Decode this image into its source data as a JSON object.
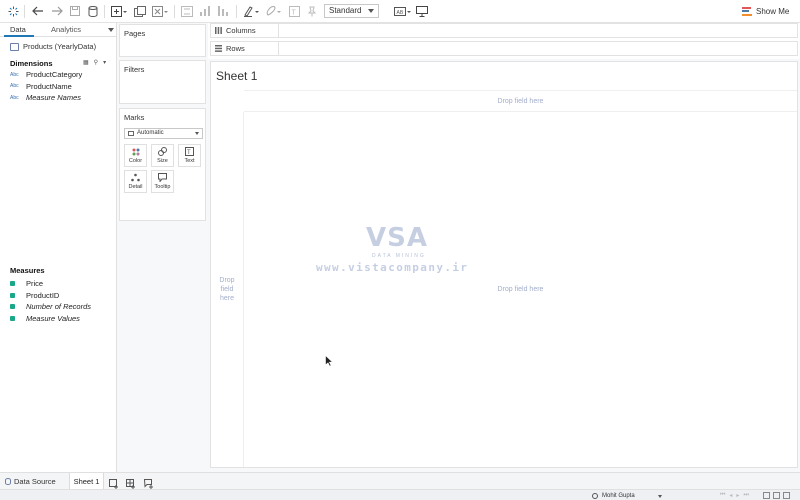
{
  "toolbar": {
    "standard_label": "Standard",
    "show_me_label": "Show Me",
    "show_me_colors": [
      "#e15759",
      "#4e79a7",
      "#f28e2b"
    ],
    "icons": [
      "tableau-logo-icon",
      "undo-icon",
      "redo-icon",
      "save-icon",
      "new-datasource-icon",
      "new-worksheet-icon",
      "duplicate-icon",
      "clear-icon",
      "swap-icon",
      "sort-ascending-icon",
      "sort-descending-icon",
      "highlight-icon",
      "group-icon",
      "label-icon",
      "pin-icon",
      "fit-icon",
      "presentation-icon"
    ]
  },
  "data_pane": {
    "tabs": {
      "data": "Data",
      "analytics": "Analytics"
    },
    "datasource": "Products (YearlyData)",
    "dimensions_header": "Dimensions",
    "dimensions": [
      {
        "type": "Abc",
        "name": "ProductCategory",
        "italic": false
      },
      {
        "type": "Abc",
        "name": "ProductName",
        "italic": false
      },
      {
        "type": "Abc",
        "name": "Measure Names",
        "italic": true
      }
    ],
    "measures_header": "Measures",
    "measures": [
      {
        "type": "#",
        "name": "Price",
        "italic": false
      },
      {
        "type": "#",
        "name": "ProductID",
        "italic": false
      },
      {
        "type": "=#",
        "name": "Number of Records",
        "italic": true
      },
      {
        "type": "#",
        "name": "Measure Values",
        "italic": true
      }
    ],
    "accent_color": "#1f77b4",
    "measure_color": "#1aa88a"
  },
  "cards": {
    "pages": "Pages",
    "filters": "Filters",
    "marks": "Marks",
    "marks_type": "Automatic",
    "mark_buttons": [
      {
        "label": "Color",
        "icon": "color-dots-icon"
      },
      {
        "label": "Size",
        "icon": "size-icon"
      },
      {
        "label": "Text",
        "icon": "text-icon"
      },
      {
        "label": "Detail",
        "icon": "detail-icon"
      },
      {
        "label": "Tooltip",
        "icon": "tooltip-icon"
      }
    ]
  },
  "shelves": {
    "columns": "Columns",
    "rows": "Rows"
  },
  "view": {
    "sheet_title": "Sheet 1",
    "drop_top": "Drop field here",
    "drop_left_lines": [
      "Drop",
      "field",
      "here"
    ],
    "drop_main": "Drop field here"
  },
  "watermark": {
    "logo": "VSA",
    "subtitle": "DATA MINING",
    "url": "www.vistacompany.ir"
  },
  "bottom_bar": {
    "data_source": "Data Source",
    "sheet_tab": "Sheet 1",
    "user": "Mohit Gupta"
  }
}
